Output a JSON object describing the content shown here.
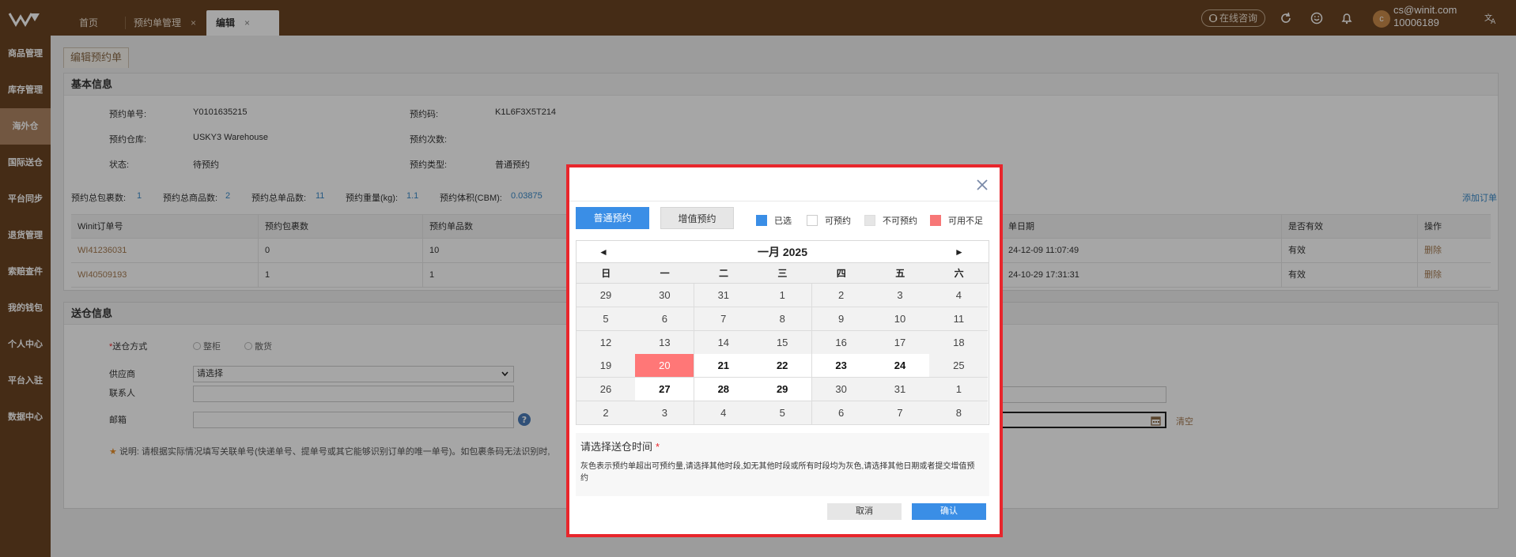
{
  "topbar": {
    "tabs": [
      {
        "label": "首页",
        "closable": false
      },
      {
        "label": "预约单管理",
        "closable": true
      },
      {
        "label": "编辑",
        "closable": true
      }
    ],
    "close_glyph": "×",
    "consult_label": "在线咨询",
    "avatar_letter": "c",
    "user_email": "cs@winit.com",
    "user_id": "10006189",
    "icons": [
      "refresh-icon",
      "smile-icon",
      "bell-icon",
      "translate-icon"
    ]
  },
  "sidebar": {
    "items": [
      "商品管理",
      "库存管理",
      "海外仓",
      "国际送仓",
      "平台同步",
      "退货管理",
      "索赔查件",
      "我的钱包",
      "个人中心",
      "平台入驻",
      "数据中心"
    ],
    "active_index": 2
  },
  "page": {
    "edit_tab": "编辑预约单",
    "basic": {
      "title": "基本信息",
      "order_no_label": "预约单号:",
      "order_no": "Y0101635215",
      "code_label": "预约码:",
      "code": "K1L6F3X5T214",
      "warehouse_label": "预约仓库:",
      "warehouse": "USKY3 Warehouse",
      "times_label": "预约次数:",
      "status_label": "状态:",
      "status": "待预约",
      "type_label": "预约类型:",
      "type": "普通预约"
    },
    "totals": [
      {
        "label": "预约总包裹数:",
        "value": "1"
      },
      {
        "label": "预约总商品数:",
        "value": "2"
      },
      {
        "label": "预约总单品数:",
        "value": "11"
      },
      {
        "label": "预约重量(kg):",
        "value": "1.1"
      },
      {
        "label": "预约体积(CBM):",
        "value": "0.03875"
      }
    ],
    "add_order": "添加订单",
    "table": {
      "headers": [
        "Winit订单号",
        "预约包裹数",
        "预约单品数",
        "单日期",
        "是否有效",
        "操作"
      ],
      "rows": [
        {
          "order": "WI41236031",
          "packages": "0",
          "items": "10",
          "date": "24-12-09 11:07:49",
          "valid": "有效",
          "action": "删除"
        },
        {
          "order": "WI40509193",
          "packages": "1",
          "items": "1",
          "date": "24-10-29 17:31:31",
          "valid": "有效",
          "action": "删除"
        }
      ]
    },
    "delivery": {
      "title": "送仓信息",
      "method_label": "送仓方式",
      "method_required": "*",
      "method_options": [
        "整柜",
        "散货"
      ],
      "supplier_label": "供应商",
      "supplier_value": "请选择",
      "contact_label": "联系人",
      "email_label": "邮箱",
      "clear_label": "清空",
      "note_star": "★",
      "note": "说明: 请根据实际情况填写关联单号(快递单号、提单号或其它能够识别订单的唯一单号)。如包裹条码无法识别时,"
    }
  },
  "dialog": {
    "close_glyph": "✕",
    "mode_normal": "普通预约",
    "mode_value_added": "增值预约",
    "legend": [
      {
        "label": "已选",
        "color": "#3a8ee6"
      },
      {
        "label": "可预约",
        "color": "#ffffff"
      },
      {
        "label": "不可预约",
        "color": "#e6e6e6"
      },
      {
        "label": "可用不足",
        "color": "#f77777"
      }
    ],
    "calendar": {
      "title": "一月  2025",
      "prev": "◄",
      "next": "►",
      "weekdays": [
        "日",
        "一",
        "二",
        "三",
        "四",
        "五",
        "六"
      ],
      "weeks": [
        [
          {
            "d": "29",
            "s": "na"
          },
          {
            "d": "30",
            "s": "na"
          },
          {
            "d": "31",
            "s": "na"
          },
          {
            "d": "1",
            "s": "na"
          },
          {
            "d": "2",
            "s": "na"
          },
          {
            "d": "3",
            "s": "na"
          },
          {
            "d": "4",
            "s": "na"
          }
        ],
        [
          {
            "d": "5",
            "s": "na"
          },
          {
            "d": "6",
            "s": "na"
          },
          {
            "d": "7",
            "s": "na"
          },
          {
            "d": "8",
            "s": "na"
          },
          {
            "d": "9",
            "s": "na"
          },
          {
            "d": "10",
            "s": "na"
          },
          {
            "d": "11",
            "s": "na"
          }
        ],
        [
          {
            "d": "12",
            "s": "na"
          },
          {
            "d": "13",
            "s": "na"
          },
          {
            "d": "14",
            "s": "na"
          },
          {
            "d": "15",
            "s": "na"
          },
          {
            "d": "16",
            "s": "na"
          },
          {
            "d": "17",
            "s": "na"
          },
          {
            "d": "18",
            "s": "na"
          }
        ],
        [
          {
            "d": "19",
            "s": "na"
          },
          {
            "d": "20",
            "s": "short"
          },
          {
            "d": "21",
            "s": "avail"
          },
          {
            "d": "22",
            "s": "avail"
          },
          {
            "d": "23",
            "s": "avail"
          },
          {
            "d": "24",
            "s": "avail"
          },
          {
            "d": "25",
            "s": "na"
          }
        ],
        [
          {
            "d": "26",
            "s": "na"
          },
          {
            "d": "27",
            "s": "avail"
          },
          {
            "d": "28",
            "s": "avail"
          },
          {
            "d": "29",
            "s": "avail"
          },
          {
            "d": "30",
            "s": "na"
          },
          {
            "d": "31",
            "s": "na"
          },
          {
            "d": "1",
            "s": "na"
          }
        ],
        [
          {
            "d": "2",
            "s": "na"
          },
          {
            "d": "3",
            "s": "na"
          },
          {
            "d": "4",
            "s": "na"
          },
          {
            "d": "5",
            "s": "na"
          },
          {
            "d": "6",
            "s": "na"
          },
          {
            "d": "7",
            "s": "na"
          },
          {
            "d": "8",
            "s": "na"
          }
        ]
      ]
    },
    "select_time_label": "请选择送仓时间",
    "required_mark": "*",
    "hint": "灰色表示预约单超出可预约量,请选择其他时段,如无其他时段或所有时段均为灰色,请选择其他日期或者提交增值预约",
    "cancel_label": "取消",
    "confirm_label": "确认"
  }
}
